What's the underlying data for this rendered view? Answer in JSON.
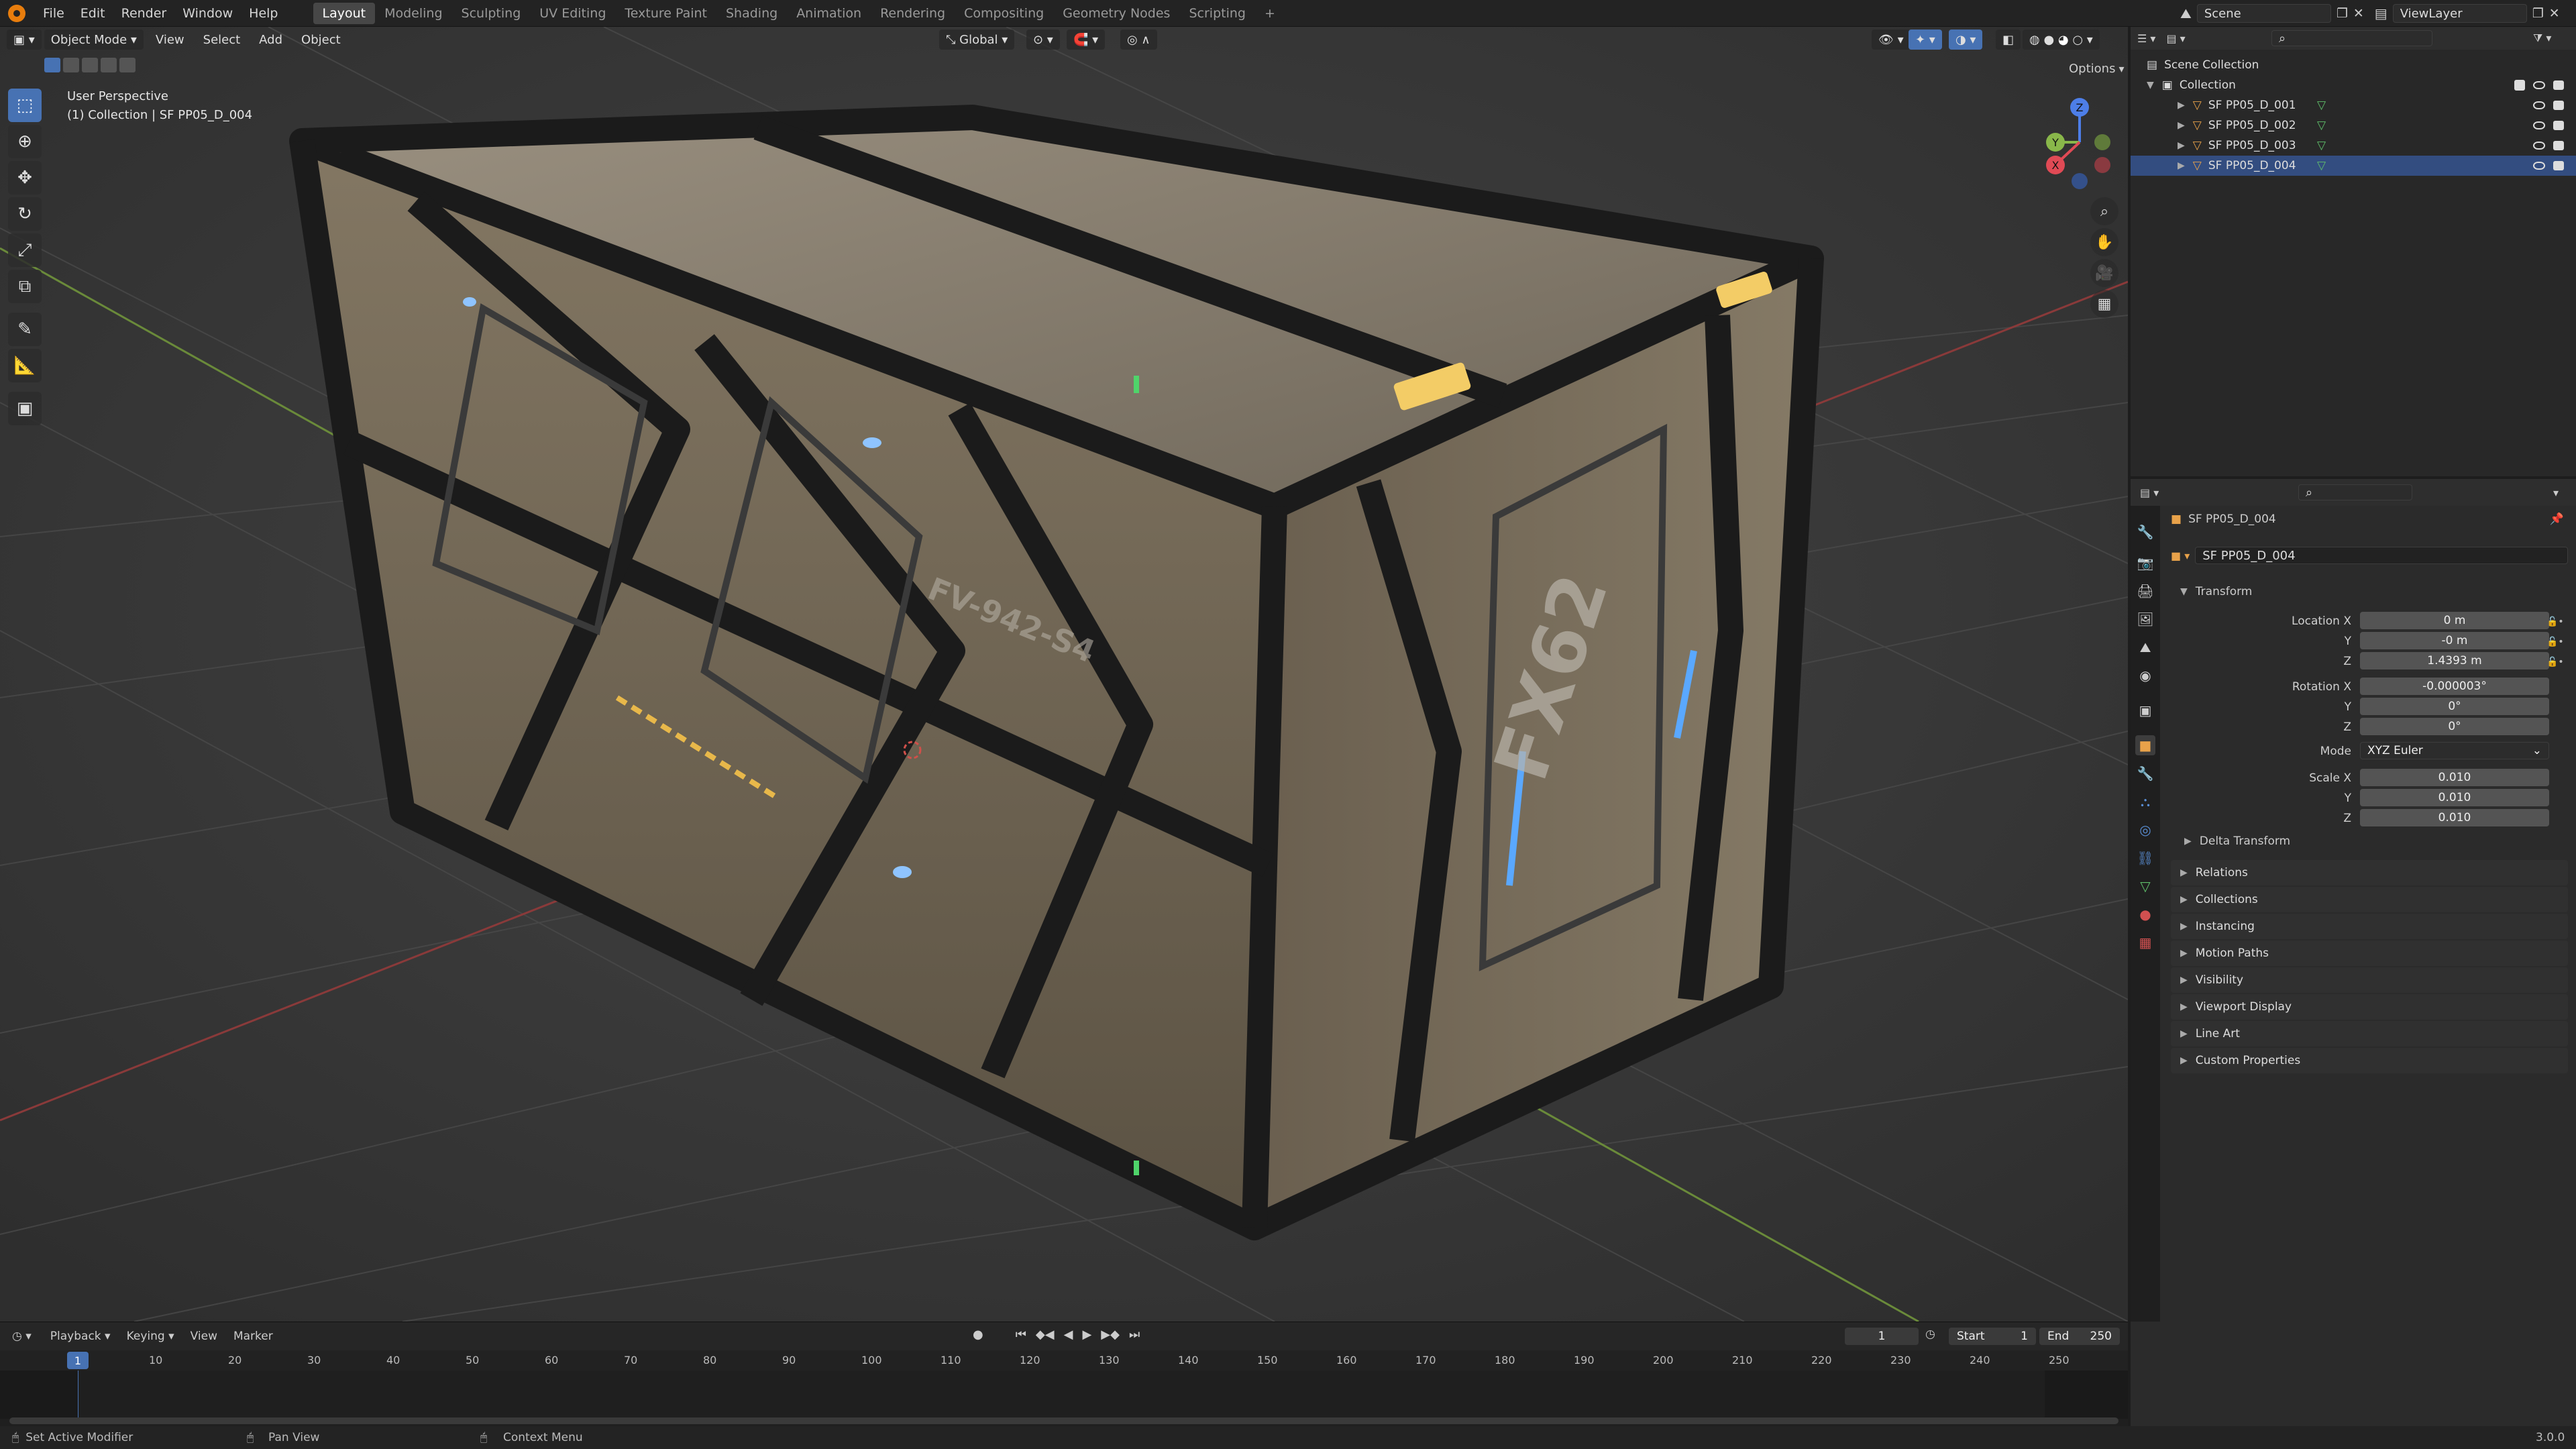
{
  "topbar": {
    "menus": [
      "File",
      "Edit",
      "Render",
      "Window",
      "Help"
    ],
    "workspaces": [
      "Layout",
      "Modeling",
      "Sculpting",
      "UV Editing",
      "Texture Paint",
      "Shading",
      "Animation",
      "Rendering",
      "Compositing",
      "Geometry Nodes",
      "Scripting"
    ],
    "active_workspace": "Layout",
    "add_tab": "+",
    "scene_label": "Scene",
    "viewlayer_label": "ViewLayer"
  },
  "viewport": {
    "mode": "Object Mode",
    "menus": [
      "View",
      "Select",
      "Add",
      "Object"
    ],
    "transform_orientation": "Global",
    "options_label": "Options",
    "overlay_line1": "User Perspective",
    "overlay_line2": "(1) Collection | SF PP05_D_004",
    "gizmo": {
      "x": "X",
      "y": "Y",
      "z": "Z"
    },
    "crate_label_1": "FX62",
    "crate_label_2": "FV-942-S4"
  },
  "outliner": {
    "scene_collection": "Scene Collection",
    "collection": "Collection",
    "items": [
      "SF PP05_D_001",
      "SF PP05_D_002",
      "SF PP05_D_003",
      "SF PP05_D_004"
    ]
  },
  "properties": {
    "object_name": "SF PP05_D_004",
    "object_field": "SF PP05_D_004",
    "transform_title": "Transform",
    "location_label": "Location X",
    "rotation_label": "Rotation X",
    "scale_label": "Scale X",
    "y_label": "Y",
    "z_label": "Z",
    "location": [
      "0 m",
      "-0 m",
      "1.4393 m"
    ],
    "rotation": [
      "-0.000003°",
      "0°",
      "0°"
    ],
    "mode_label": "Mode",
    "mode_value": "XYZ Euler",
    "scale": [
      "0.010",
      "0.010",
      "0.010"
    ],
    "delta_transform": "Delta Transform",
    "panels": [
      "Relations",
      "Collections",
      "Instancing",
      "Motion Paths",
      "Visibility",
      "Viewport Display",
      "Line Art",
      "Custom Properties"
    ]
  },
  "timeline": {
    "menus": [
      "Playback",
      "Keying",
      "View",
      "Marker"
    ],
    "current_frame": "1",
    "start_label": "Start",
    "start_value": "1",
    "end_label": "End",
    "end_value": "250",
    "ticks": [
      "10",
      "20",
      "30",
      "40",
      "50",
      "60",
      "70",
      "80",
      "90",
      "100",
      "110",
      "120",
      "130",
      "140",
      "150",
      "160",
      "170",
      "180",
      "190",
      "200",
      "210",
      "220",
      "230",
      "240",
      "250"
    ]
  },
  "statusbar": {
    "left": "Set Active Modifier",
    "middle": "Pan View",
    "right": "Context Menu",
    "version": "3.0.0"
  },
  "colors": {
    "accent": "#4772b3",
    "orange": "#e87d0d",
    "object_icon": "#e8a24a",
    "mesh_icon": "#5fbf6a"
  }
}
